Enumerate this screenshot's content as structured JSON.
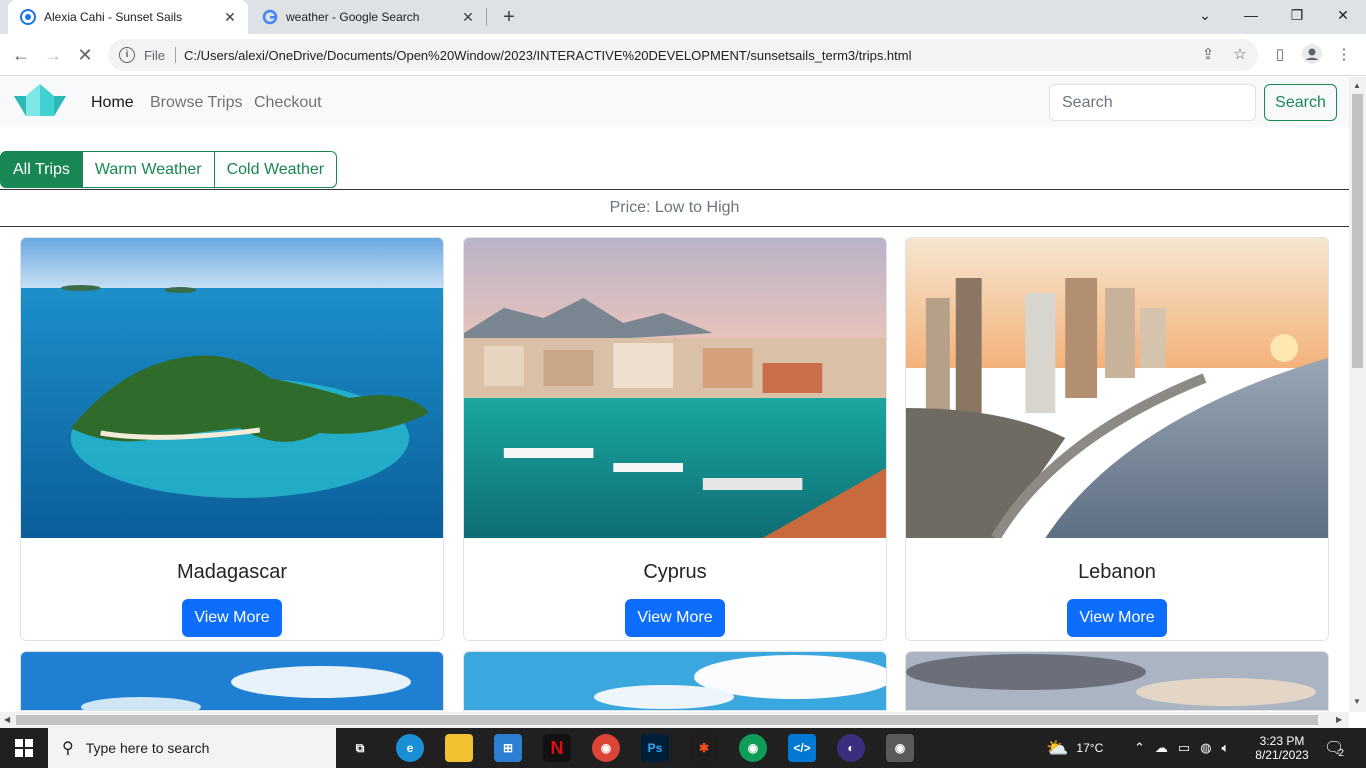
{
  "browser": {
    "tabs": [
      {
        "title": "Alexia Cahi - Sunset Sails",
        "active": true
      },
      {
        "title": "weather - Google Search",
        "active": false
      }
    ],
    "address": {
      "scheme_label": "File",
      "url": "C:/Users/alexi/OneDrive/Documents/Open%20Window/2023/INTERACTIVE%20DEVELOPMENT/sunsetsails_term3/trips.html"
    }
  },
  "site": {
    "nav": {
      "home": "Home",
      "browse": "Browse Trips",
      "checkout": "Checkout"
    },
    "search": {
      "placeholder": "Search",
      "button": "Search"
    },
    "filters": [
      "All Trips",
      "Warm Weather",
      "Cold Weather"
    ],
    "active_filter": "All Trips",
    "sort_label": "Price: Low to High",
    "cards": [
      {
        "name": "Madagascar",
        "button": "View More"
      },
      {
        "name": "Cyprus",
        "button": "View More"
      },
      {
        "name": "Lebanon",
        "button": "View More"
      }
    ]
  },
  "taskbar": {
    "search_placeholder": "Type here to search",
    "weather": "17°C",
    "time": "3:23 PM",
    "date": "8/21/2023",
    "notifications": "2"
  },
  "colors": {
    "accent_green": "#198754",
    "primary_blue": "#0d6efd"
  }
}
